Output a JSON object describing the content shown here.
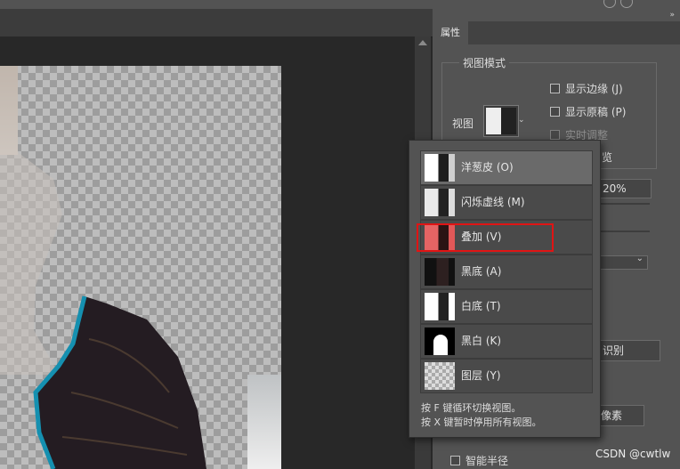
{
  "panel": {
    "tab_label": "属性",
    "collapse_glyph": "»",
    "view_mode_title": "视图模式",
    "view_label": "视图",
    "show_edge": "显示边缘 (J)",
    "show_original": "显示原稿 (P)",
    "realtime_adjust": "实时调整",
    "preview_partial": "览",
    "percent_value": "20%",
    "recognize_partial": "识别",
    "pixels_partial": "像素",
    "smart_radius": "智能半径"
  },
  "popup": {
    "items": [
      {
        "label": "洋葱皮 (O)",
        "icon": "onion-skin-thumb"
      },
      {
        "label": "闪烁虚线 (M)",
        "icon": "marching-ants-thumb"
      },
      {
        "label": "叠加 (V)",
        "icon": "overlay-thumb"
      },
      {
        "label": "黑底 (A)",
        "icon": "on-black-thumb"
      },
      {
        "label": "白底 (T)",
        "icon": "on-white-thumb"
      },
      {
        "label": "黑白 (K)",
        "icon": "black-white-thumb"
      },
      {
        "label": "图层 (Y)",
        "icon": "on-layers-thumb"
      }
    ],
    "hint_cycle": "按 F 键循环切换视图。",
    "hint_disable": "按 X 键暂时停用所有视图。"
  },
  "watermark": "CSDN @cwtlw",
  "colors": {
    "highlight": "#e01414",
    "panel_bg": "#535353",
    "canvas_bg": "#282828"
  }
}
